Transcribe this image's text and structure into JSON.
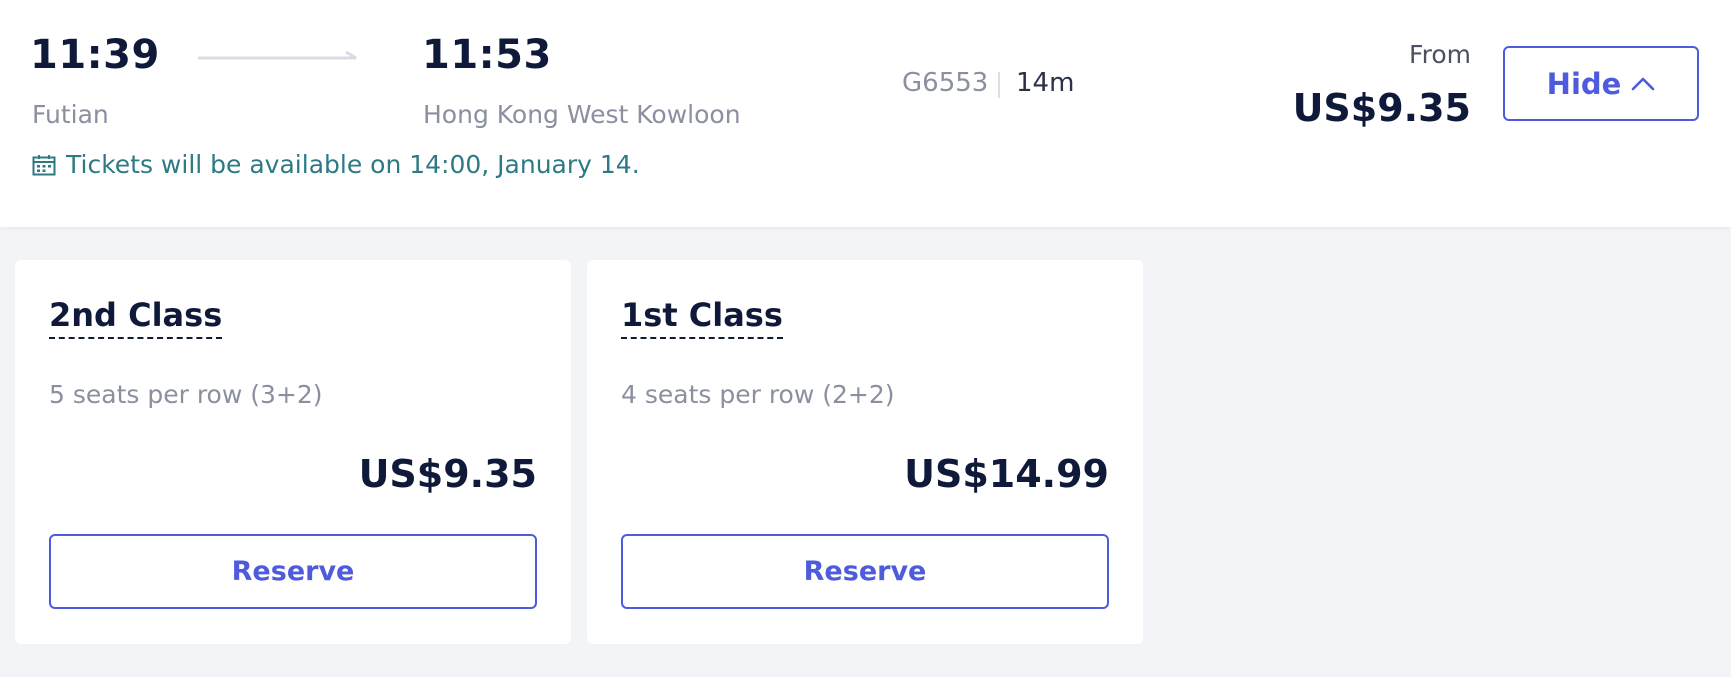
{
  "journey": {
    "depart_time": "11:39",
    "depart_station": "Futian",
    "arrive_time": "11:53",
    "arrive_station": "Hong Kong West Kowloon",
    "train_number": "G6553",
    "duration": "14m",
    "notice": "Tickets will be available on 14:00, January 14.",
    "notice_icon": "calendar-icon",
    "from_label": "From",
    "from_price": "US$9.35",
    "hide_label": "Hide",
    "hide_icon": "chevron-up-icon"
  },
  "classes": [
    {
      "name": "2nd Class",
      "seats": "5 seats per row (3+2)",
      "price": "US$9.35",
      "button": "Reserve"
    },
    {
      "name": "1st Class",
      "seats": "4 seats per row (2+2)",
      "price": "US$14.99",
      "button": "Reserve"
    }
  ],
  "colors": {
    "accent": "#4d5bdc",
    "notice": "#2e7a84",
    "text_dark": "#0f1a3a",
    "text_muted": "#8a909f",
    "background": "#f3f4f8"
  }
}
